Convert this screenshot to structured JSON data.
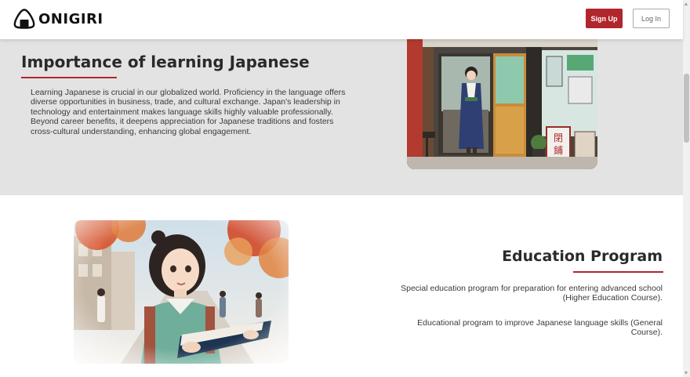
{
  "header": {
    "logo_text": "ONIGIRI",
    "logo_icon": "onigiri-icon",
    "signup_label": "Sign Up",
    "login_label": "Log In"
  },
  "importance": {
    "title": "Importance of learning Japanese",
    "body": "Learning Japanese is crucial in our globalized world. Proficiency in the language offers diverse opportunities in business, trade, and cultural exchange. Japan's leadership in technology and entertainment makes language skills highly valuable professionally. Beyond career benefits, it deepens appreciation for Japanese traditions and fosters cross-cultural understanding, enhancing global engagement.",
    "image": "japanese-shop-front-illustration"
  },
  "education": {
    "title": "Education Program",
    "items": [
      "Special education program for preparation for entering advanced school (Higher Education Course).",
      "Educational program to improve Japanese language skills (General Course)."
    ],
    "image": "girl-reading-book-autumn-street-illustration"
  },
  "colors": {
    "accent": "#b0262c",
    "section_bg": "#e4e3e3",
    "text": "#2a2a2a"
  }
}
